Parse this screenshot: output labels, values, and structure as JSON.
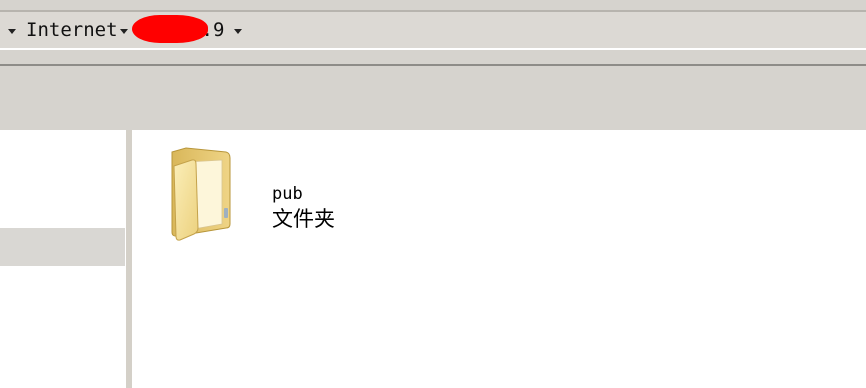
{
  "address_bar": {
    "breadcrumbs": [
      {
        "label": "Internet"
      },
      {
        "label": ".9"
      }
    ]
  },
  "content": {
    "items": [
      {
        "name": "pub",
        "type": "文件夹",
        "icon": "folder-icon"
      }
    ]
  },
  "colors": {
    "chrome": "#d6d3ce",
    "redaction": "#ff0000",
    "folder": "#f1d67f"
  }
}
